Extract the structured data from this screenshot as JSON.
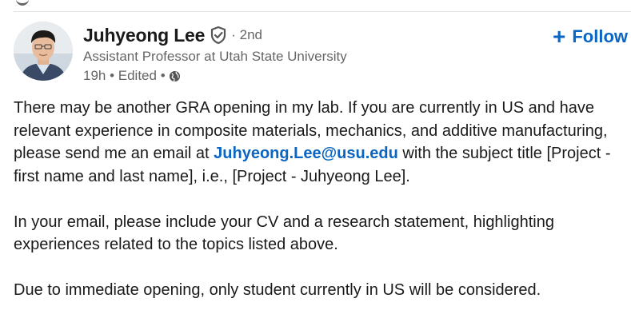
{
  "post": {
    "author": {
      "name": "Juhyeong Lee",
      "degree": "· 2nd",
      "headline": "Assistant Professor at Utah State University",
      "time_label": "19h • Edited •",
      "avatar_icon": "person-photo-avatar",
      "verified_icon": "verified-shield-icon",
      "visibility_icon": "globe-icon"
    },
    "follow_button": {
      "icon": "+",
      "label": "Follow"
    },
    "body": {
      "paragraph1_before": "There may be another GRA opening in my lab. If you are currently in US and have relevant experience in composite materials, mechanics, and additive manufacturing, please send me an email at ",
      "email": "Juhyeong.Lee@usu.edu",
      "paragraph1_after": " with the subject title [Project - first name and last name], i.e., [Project - Juhyeong Lee].",
      "paragraph2": "In your email, please include your CV and a research statement, highlighting experiences related to the topics listed above.",
      "paragraph3": "Due to immediate opening, only student currently in US will be considered."
    },
    "colors": {
      "link": "#0a66c2",
      "secondary_text": "#666666",
      "primary_text": "#1a1a1a"
    }
  }
}
